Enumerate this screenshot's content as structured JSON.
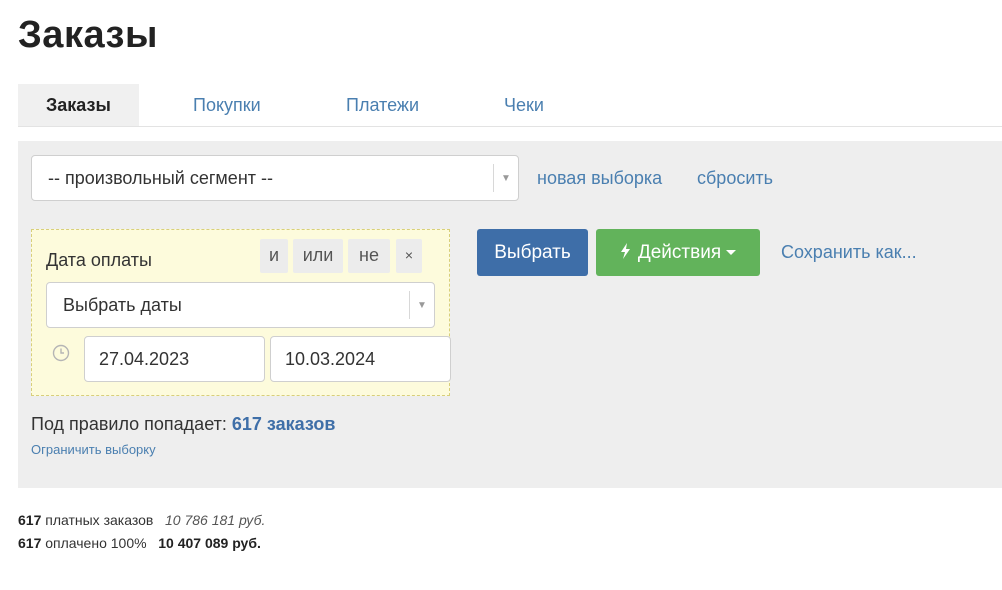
{
  "page": {
    "title": "Заказы"
  },
  "tabs": [
    {
      "label": "Заказы",
      "active": true
    },
    {
      "label": "Покупки",
      "active": false
    },
    {
      "label": "Платежи",
      "active": false
    },
    {
      "label": "Чеки",
      "active": false
    }
  ],
  "filter": {
    "segment_select": {
      "value": "-- произвольный сегмент --"
    },
    "new_selection_link": "новая выборка",
    "reset_link": "сбросить",
    "rule": {
      "label": "Дата оплаты",
      "ops": {
        "and": "и",
        "or": "или",
        "not": "не",
        "remove": "×"
      },
      "date_select": {
        "value": "Выбрать даты"
      },
      "date_from": "27.04.2023",
      "date_to": "10.03.2024",
      "icon": "clock-icon"
    },
    "select_button": "Выбрать",
    "actions_button": {
      "label": "Действия",
      "icon": "bolt-icon"
    },
    "save_as_link": "Сохранить как...",
    "match_text": "Под правило попадает:",
    "match_count": "617 заказов",
    "limit_link": "Ограничить выборку"
  },
  "summary": {
    "line1": {
      "count": "617",
      "label": "платных заказов",
      "amount": "10 786 181 руб."
    },
    "line2": {
      "count": "617",
      "label": "оплачено 100%",
      "amount": "10 407 089 руб."
    }
  },
  "colors": {
    "link": "#4a7fb0",
    "primary_button": "#3e6ea8",
    "success_button": "#62b35b",
    "rule_background": "#fdfbdc",
    "panel_background": "#eeeeee"
  }
}
